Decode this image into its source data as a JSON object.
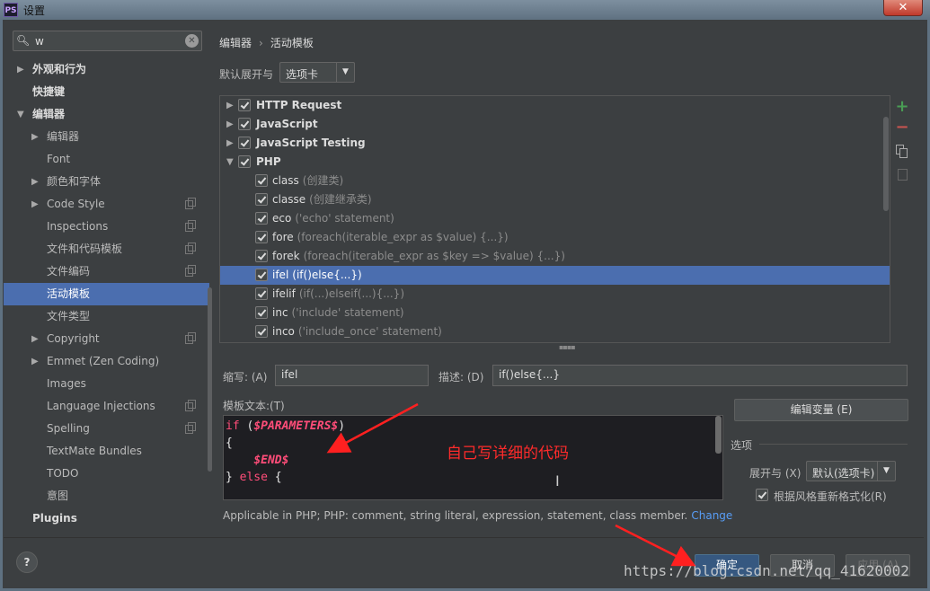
{
  "window": {
    "title": "设置",
    "app_logo": "PS",
    "close_label": "✕"
  },
  "search": {
    "value": "w"
  },
  "sidebar": {
    "items": [
      {
        "label": "外观和行为",
        "level": 0,
        "expand": "collapsed",
        "bold": true
      },
      {
        "label": "快捷键",
        "level": 0,
        "expand": "none",
        "bold": true
      },
      {
        "label": "编辑器",
        "level": 0,
        "expand": "expanded",
        "bold": true
      },
      {
        "label": "编辑器",
        "level": 1,
        "expand": "collapsed"
      },
      {
        "label": "Font",
        "level": 1,
        "expand": "none"
      },
      {
        "label": "颜色和字体",
        "level": 1,
        "expand": "collapsed"
      },
      {
        "label": "Code Style",
        "level": 1,
        "expand": "collapsed",
        "copy": true
      },
      {
        "label": "Inspections",
        "level": 1,
        "expand": "none",
        "copy": true
      },
      {
        "label": "文件和代码模板",
        "level": 1,
        "expand": "none",
        "copy": true
      },
      {
        "label": "文件编码",
        "level": 1,
        "expand": "none",
        "copy": true
      },
      {
        "label": "活动模板",
        "level": 1,
        "expand": "none",
        "selected": true
      },
      {
        "label": "文件类型",
        "level": 1,
        "expand": "none"
      },
      {
        "label": "Copyright",
        "level": 1,
        "expand": "collapsed",
        "copy": true
      },
      {
        "label": "Emmet (Zen Coding)",
        "level": 1,
        "expand": "collapsed"
      },
      {
        "label": "Images",
        "level": 1,
        "expand": "none"
      },
      {
        "label": "Language Injections",
        "level": 1,
        "expand": "none",
        "copy": true
      },
      {
        "label": "Spelling",
        "level": 1,
        "expand": "none",
        "copy": true
      },
      {
        "label": "TextMate Bundles",
        "level": 1,
        "expand": "none"
      },
      {
        "label": "TODO",
        "level": 1,
        "expand": "none"
      },
      {
        "label": "意图",
        "level": 1,
        "expand": "none"
      },
      {
        "label": "Plugins",
        "level": 0,
        "expand": "none",
        "bold": true
      }
    ]
  },
  "breadcrumb": {
    "parent": "编辑器",
    "separator": "›",
    "current": "活动模板"
  },
  "expand_with": {
    "label": "默认展开与",
    "value": "选项卡"
  },
  "templates": [
    {
      "abbr": "HTTP Request",
      "desc": "",
      "group": true,
      "expand": "collapsed",
      "checked": true
    },
    {
      "abbr": "JavaScript",
      "desc": "",
      "group": true,
      "expand": "collapsed",
      "checked": true
    },
    {
      "abbr": "JavaScript Testing",
      "desc": "",
      "group": true,
      "expand": "collapsed",
      "checked": true
    },
    {
      "abbr": "PHP",
      "desc": "",
      "group": true,
      "expand": "expanded",
      "checked": true
    },
    {
      "abbr": "class",
      "desc": "(创建类)",
      "checked": true
    },
    {
      "abbr": "classe",
      "desc": "(创建继承类)",
      "checked": true
    },
    {
      "abbr": "eco",
      "desc": "('echo' statement)",
      "checked": true
    },
    {
      "abbr": "fore",
      "desc": "(foreach(iterable_expr as $value) {...})",
      "checked": true
    },
    {
      "abbr": "forek",
      "desc": "(foreach(iterable_expr as $key => $value) {...})",
      "checked": true
    },
    {
      "abbr": "ifel",
      "desc": "(if()else{...})",
      "checked": true,
      "selected": true
    },
    {
      "abbr": "ifelif",
      "desc": "(if(...)elseif(...){...})",
      "checked": true
    },
    {
      "abbr": "inc",
      "desc": "('include' statement)",
      "checked": true
    },
    {
      "abbr": "inco",
      "desc": "('include_once' statement)",
      "checked": true
    }
  ],
  "toolbar_icons": [
    "add-icon",
    "remove-icon",
    "copy-icon",
    "edit-icon"
  ],
  "abbreviation": {
    "label": "缩写: (A)",
    "value": "ifel"
  },
  "description": {
    "label": "描述: (D)",
    "value": "if()else{...}"
  },
  "template_text": {
    "label": "模板文本:(T)",
    "lines": [
      [
        {
          "t": "if",
          "c": "kw"
        },
        {
          "t": " (",
          "c": ""
        },
        {
          "t": "$PARAMETERS$",
          "c": "var"
        },
        {
          "t": ")",
          "c": ""
        }
      ],
      [
        {
          "t": "{",
          "c": ""
        }
      ],
      [
        {
          "t": "    ",
          "c": ""
        },
        {
          "t": "$END$",
          "c": "var"
        }
      ],
      [
        {
          "t": "} ",
          "c": ""
        },
        {
          "t": "else",
          "c": "kw"
        },
        {
          "t": " {",
          "c": ""
        }
      ]
    ]
  },
  "annotation": {
    "text": "自己写详细的代码"
  },
  "edit_variables_button": "编辑变量 (E)",
  "options": {
    "title": "选项",
    "expand_label": "展开与 (X)",
    "expand_value": "默认(选项卡)",
    "reformat_label": "根据风格重新格式化(R)",
    "reformat_checked": true
  },
  "applicable": {
    "text": "Applicable in PHP; PHP: comment, string literal, expression, statement, class member.",
    "link": "Change"
  },
  "buttons": {
    "ok": "确定",
    "cancel": "取消",
    "apply": "应用 (A)",
    "help": "?"
  },
  "watermark": "https://blog.csdn.net/qq_41620002",
  "colors": {
    "selection": "#4b6eaf",
    "background": "#3c3f41",
    "annotation": "#ff2b2b",
    "keyword": "#ff4d79",
    "link": "#589df6"
  }
}
